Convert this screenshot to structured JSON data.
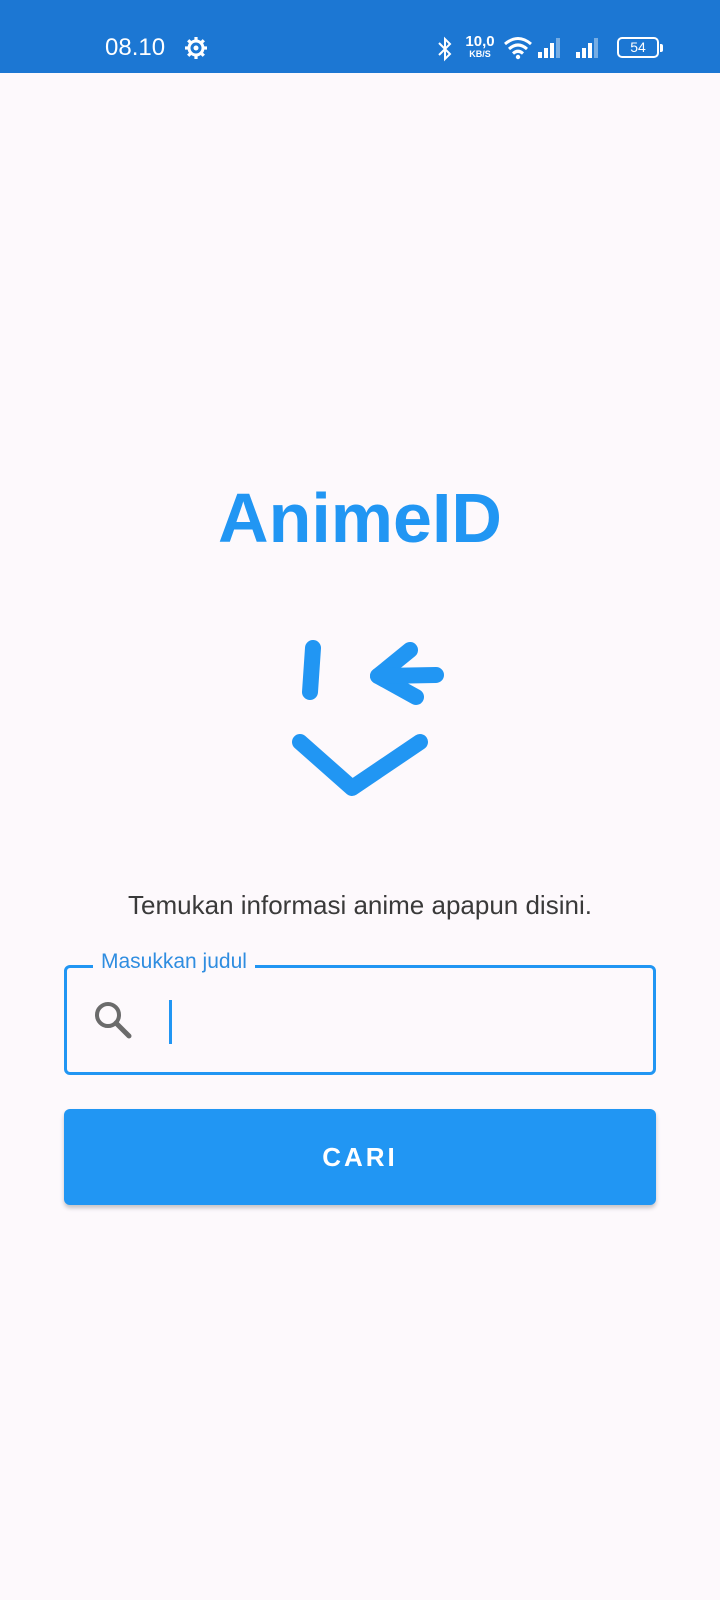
{
  "status_bar": {
    "time": "08.10",
    "net_speed_value": "10,0",
    "net_speed_unit": "KB/S",
    "battery_level": "54",
    "icons": [
      "gear-icon",
      "bluetooth-icon",
      "wifi-icon",
      "signal-icon",
      "signal-icon",
      "battery-icon"
    ]
  },
  "app": {
    "title": "AnimeID",
    "logo_icon": "face-logo-icon",
    "tagline": "Temukan informasi anime apapun disini."
  },
  "search": {
    "label": "Masukkan judul",
    "value": "",
    "icon": "search-icon"
  },
  "actions": {
    "search_button_label": "CARI"
  },
  "colors": {
    "status_bar": "#1c77d3",
    "accent": "#2196f3",
    "background": "#fdf9fc",
    "text": "#3a3a3a"
  }
}
